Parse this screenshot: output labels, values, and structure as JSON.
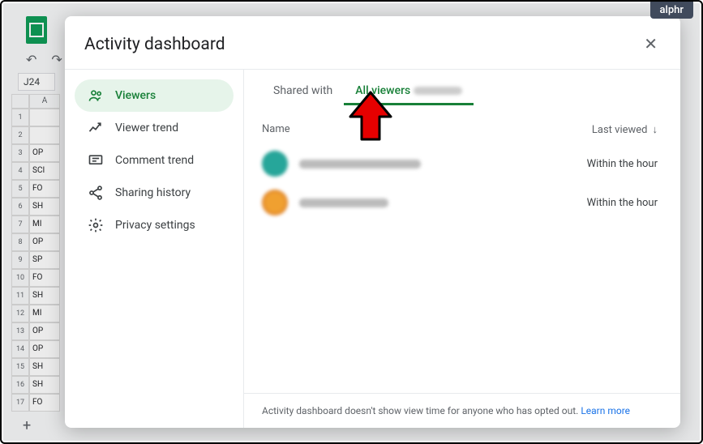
{
  "watermark": "alphr",
  "cell_reference": "J24",
  "column_header": "A",
  "row_data": [
    {
      "num": "1",
      "val": ""
    },
    {
      "num": "2",
      "val": ""
    },
    {
      "num": "3",
      "val": "OP"
    },
    {
      "num": "4",
      "val": "SCI"
    },
    {
      "num": "5",
      "val": "FO"
    },
    {
      "num": "6",
      "val": "SH"
    },
    {
      "num": "7",
      "val": "MI"
    },
    {
      "num": "8",
      "val": "OP"
    },
    {
      "num": "9",
      "val": "SP"
    },
    {
      "num": "10",
      "val": "FO"
    },
    {
      "num": "11",
      "val": "SH"
    },
    {
      "num": "12",
      "val": "MI"
    },
    {
      "num": "13",
      "val": "OP"
    },
    {
      "num": "14",
      "val": "OP"
    },
    {
      "num": "15",
      "val": "SH"
    },
    {
      "num": "16",
      "val": "SH"
    },
    {
      "num": "17",
      "val": "FO"
    }
  ],
  "dialog": {
    "title": "Activity dashboard",
    "sidebar": {
      "items": [
        {
          "label": "Viewers"
        },
        {
          "label": "Viewer trend"
        },
        {
          "label": "Comment trend"
        },
        {
          "label": "Sharing history"
        },
        {
          "label": "Privacy settings"
        }
      ]
    },
    "tabs": {
      "shared_with": "Shared with",
      "all_viewers": "All viewers"
    },
    "columns": {
      "name": "Name",
      "last_viewed": "Last viewed"
    },
    "viewers": [
      {
        "time": "Within the hour"
      },
      {
        "time": "Within the hour"
      }
    ],
    "footer": {
      "text": "Activity dashboard doesn't show view time for anyone who has opted out. ",
      "link": "Learn more"
    }
  }
}
